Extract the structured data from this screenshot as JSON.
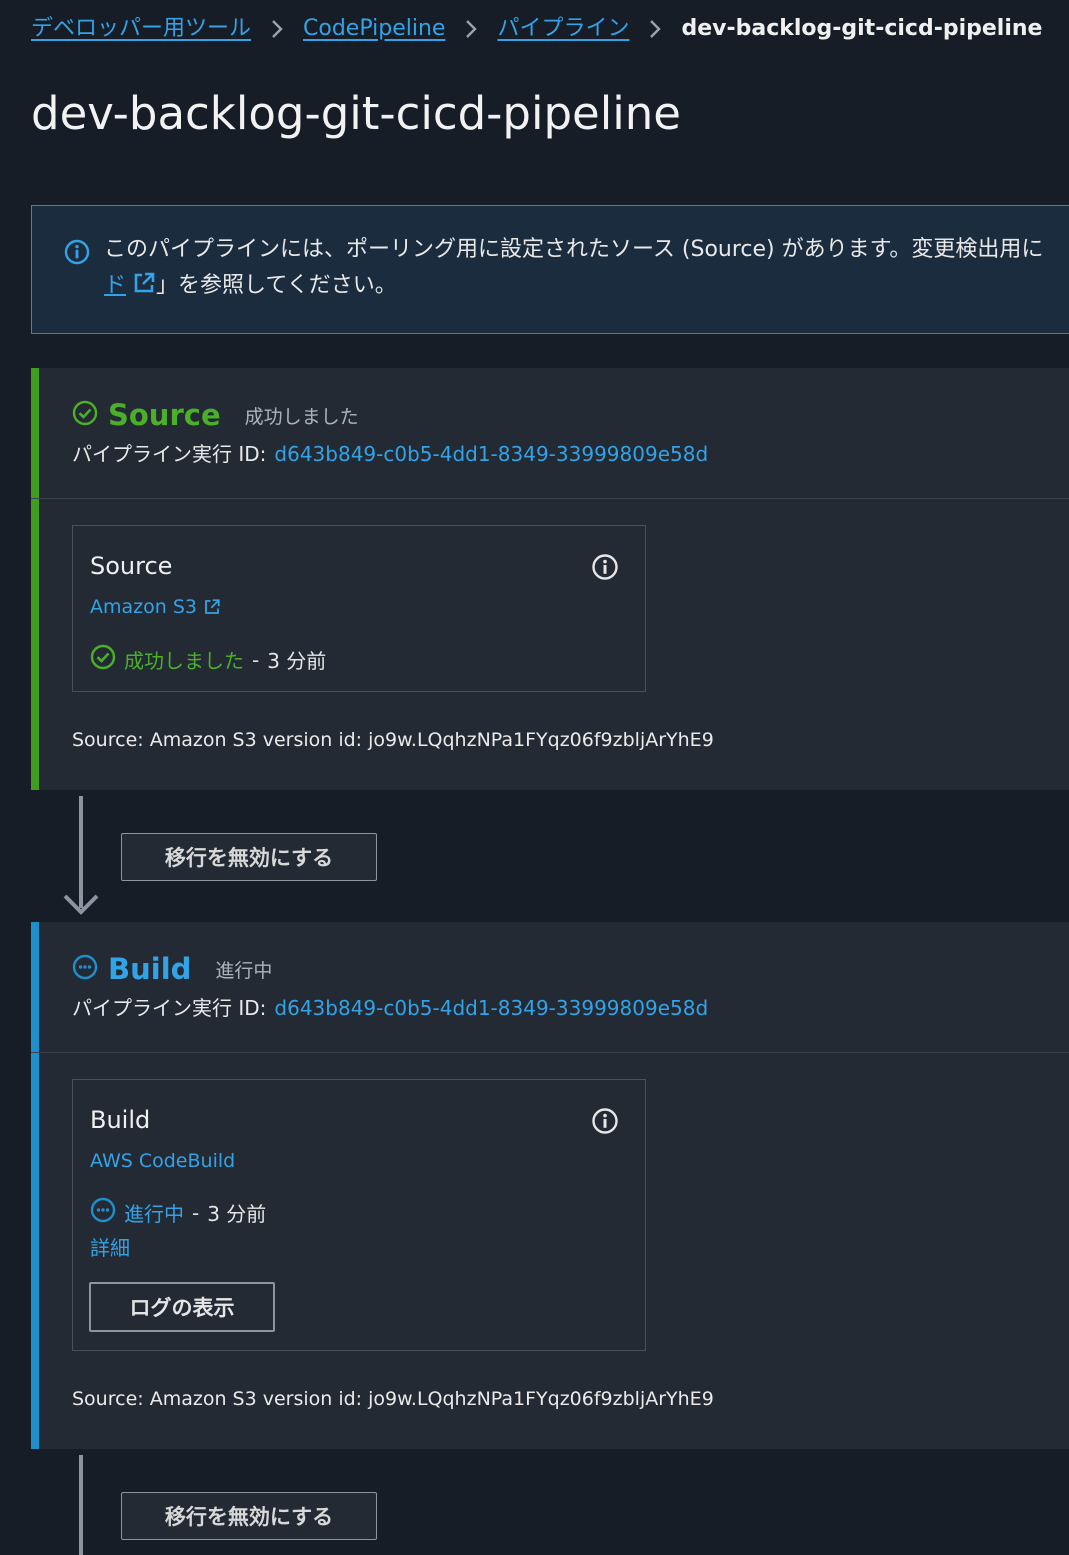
{
  "colors": {
    "success": "#4caf2a",
    "in_progress": "#1f8fcc",
    "link": "#33a3e8",
    "background": "#161d26",
    "panel": "#232a33"
  },
  "breadcrumb": {
    "items": [
      "デベロッパー用ツール",
      "CodePipeline",
      "パイプライン"
    ],
    "current": "dev-backlog-git-cicd-pipeline"
  },
  "page_title": "dev-backlog-git-cicd-pipeline",
  "banner": {
    "icon": "info-icon",
    "text_part1": "このパイプラインには、ポーリング用に設定されたソース (Source) があります。変更検出用に",
    "link_text": "ド",
    "text_part2": "」を参照してください。"
  },
  "stages": [
    {
      "name": "Source",
      "status": "成功しました",
      "exec_label": "パイプライン実行 ID:",
      "exec_id": "d643b849-c0b5-4dd1-8349-33999809e58d",
      "action": {
        "title": "Source",
        "provider": "Amazon S3",
        "status": "成功しました",
        "ago": "3 分前"
      },
      "source_text": "Source: Amazon S3 version id: jo9w.LQqhzNPa1FYqz06f9zbljArYhE9"
    },
    {
      "name": "Build",
      "status": "進行中",
      "exec_label": "パイプライン実行 ID:",
      "exec_id": "d643b849-c0b5-4dd1-8349-33999809e58d",
      "action": {
        "title": "Build",
        "provider": "AWS CodeBuild",
        "status": "進行中",
        "ago": "3 分前",
        "details": "詳細",
        "log_button": "ログの表示"
      },
      "source_text": "Source: Amazon S3 version id: jo9w.LQqhzNPa1FYqz06f9zbljArYhE9"
    }
  ],
  "transitions": [
    {
      "button": "移行を無効にする"
    },
    {
      "button": "移行を無効にする"
    }
  ]
}
